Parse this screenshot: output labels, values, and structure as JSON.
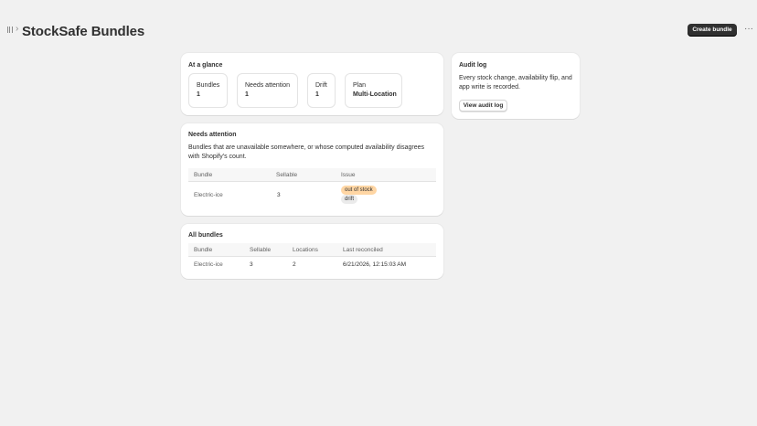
{
  "header": {
    "title": "StockSafe Bundles",
    "chevron": "›",
    "create_button": "Create bundle",
    "more_button": "···"
  },
  "glance": {
    "title": "At a glance",
    "stats": [
      {
        "label": "Bundles",
        "value": "1"
      },
      {
        "label": "Needs attention",
        "value": "1"
      },
      {
        "label": "Drift",
        "value": "1"
      },
      {
        "label": "Plan",
        "value": "Multi-Location"
      }
    ]
  },
  "audit": {
    "title": "Audit log",
    "description": "Every stock change, availability flip, and app write is recorded.",
    "button": "View audit log"
  },
  "attention": {
    "title": "Needs attention",
    "description": "Bundles that are unavailable somewhere, or whose computed availability disagrees with Shopify's count.",
    "columns": [
      "Bundle",
      "Sellable",
      "Issue"
    ],
    "rows": [
      {
        "bundle": "Electric-ice",
        "sellable": "3",
        "issues": [
          "out of stock",
          "drift"
        ]
      }
    ],
    "badge_colors": {
      "out_of_stock": "#ffd6a4",
      "drift": "#ebebeb"
    }
  },
  "all": {
    "title": "All bundles",
    "columns": [
      "Bundle",
      "Sellable",
      "Locations",
      "Last reconciled"
    ],
    "rows": [
      {
        "bundle": "Electric-ice",
        "sellable": "3",
        "locations": "2",
        "last": "6/21/2026, 12:15:03 AM"
      }
    ]
  }
}
